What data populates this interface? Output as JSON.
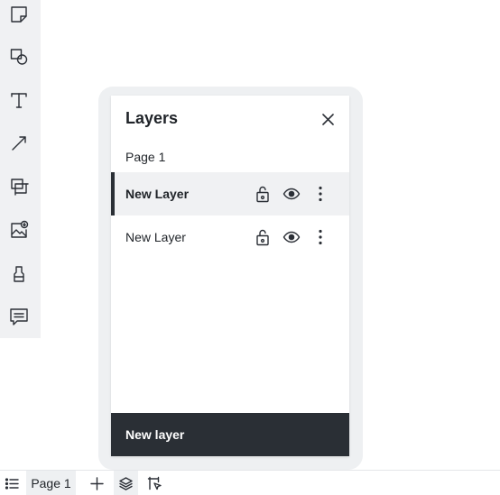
{
  "tool_rail": {
    "tools": [
      {
        "name": "sticky-note-icon"
      },
      {
        "name": "shapes-icon"
      },
      {
        "name": "text-icon"
      },
      {
        "name": "arrow-line-icon"
      },
      {
        "name": "frame-icon"
      },
      {
        "name": "image-upload-icon"
      },
      {
        "name": "marker-icon"
      },
      {
        "name": "comment-icon"
      }
    ]
  },
  "layers_panel": {
    "title": "Layers",
    "page_name": "Page 1",
    "layers": [
      {
        "label": "New Layer",
        "selected": true,
        "locked": false,
        "visible": true
      },
      {
        "label": "New Layer",
        "selected": false,
        "locked": false,
        "visible": true
      }
    ],
    "new_layer_label": "New layer"
  },
  "bottom_bar": {
    "page_tab_label": "Page 1"
  },
  "colors": {
    "rail_background": "#f0f1f3",
    "selected_row": "#f0f1f3",
    "accent_dark": "#2a2f35",
    "icon_stroke": "#2b2f36"
  }
}
